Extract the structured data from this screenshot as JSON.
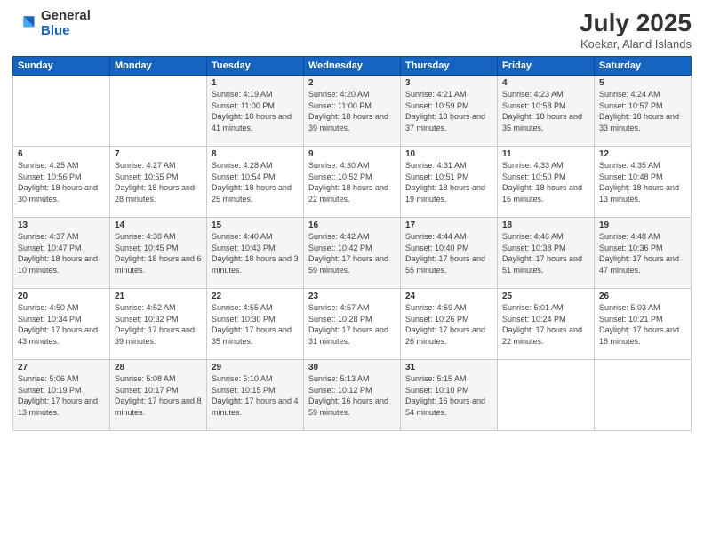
{
  "logo": {
    "general": "General",
    "blue": "Blue"
  },
  "header": {
    "month": "July 2025",
    "location": "Koekar, Aland Islands"
  },
  "weekdays": [
    "Sunday",
    "Monday",
    "Tuesday",
    "Wednesday",
    "Thursday",
    "Friday",
    "Saturday"
  ],
  "weeks": [
    [
      {
        "day": "",
        "info": ""
      },
      {
        "day": "",
        "info": ""
      },
      {
        "day": "1",
        "info": "Sunrise: 4:19 AM\nSunset: 11:00 PM\nDaylight: 18 hours\nand 41 minutes."
      },
      {
        "day": "2",
        "info": "Sunrise: 4:20 AM\nSunset: 11:00 PM\nDaylight: 18 hours\nand 39 minutes."
      },
      {
        "day": "3",
        "info": "Sunrise: 4:21 AM\nSunset: 10:59 PM\nDaylight: 18 hours\nand 37 minutes."
      },
      {
        "day": "4",
        "info": "Sunrise: 4:23 AM\nSunset: 10:58 PM\nDaylight: 18 hours\nand 35 minutes."
      },
      {
        "day": "5",
        "info": "Sunrise: 4:24 AM\nSunset: 10:57 PM\nDaylight: 18 hours\nand 33 minutes."
      }
    ],
    [
      {
        "day": "6",
        "info": "Sunrise: 4:25 AM\nSunset: 10:56 PM\nDaylight: 18 hours\nand 30 minutes."
      },
      {
        "day": "7",
        "info": "Sunrise: 4:27 AM\nSunset: 10:55 PM\nDaylight: 18 hours\nand 28 minutes."
      },
      {
        "day": "8",
        "info": "Sunrise: 4:28 AM\nSunset: 10:54 PM\nDaylight: 18 hours\nand 25 minutes."
      },
      {
        "day": "9",
        "info": "Sunrise: 4:30 AM\nSunset: 10:52 PM\nDaylight: 18 hours\nand 22 minutes."
      },
      {
        "day": "10",
        "info": "Sunrise: 4:31 AM\nSunset: 10:51 PM\nDaylight: 18 hours\nand 19 minutes."
      },
      {
        "day": "11",
        "info": "Sunrise: 4:33 AM\nSunset: 10:50 PM\nDaylight: 18 hours\nand 16 minutes."
      },
      {
        "day": "12",
        "info": "Sunrise: 4:35 AM\nSunset: 10:48 PM\nDaylight: 18 hours\nand 13 minutes."
      }
    ],
    [
      {
        "day": "13",
        "info": "Sunrise: 4:37 AM\nSunset: 10:47 PM\nDaylight: 18 hours\nand 10 minutes."
      },
      {
        "day": "14",
        "info": "Sunrise: 4:38 AM\nSunset: 10:45 PM\nDaylight: 18 hours\nand 6 minutes."
      },
      {
        "day": "15",
        "info": "Sunrise: 4:40 AM\nSunset: 10:43 PM\nDaylight: 18 hours\nand 3 minutes."
      },
      {
        "day": "16",
        "info": "Sunrise: 4:42 AM\nSunset: 10:42 PM\nDaylight: 17 hours\nand 59 minutes."
      },
      {
        "day": "17",
        "info": "Sunrise: 4:44 AM\nSunset: 10:40 PM\nDaylight: 17 hours\nand 55 minutes."
      },
      {
        "day": "18",
        "info": "Sunrise: 4:46 AM\nSunset: 10:38 PM\nDaylight: 17 hours\nand 51 minutes."
      },
      {
        "day": "19",
        "info": "Sunrise: 4:48 AM\nSunset: 10:36 PM\nDaylight: 17 hours\nand 47 minutes."
      }
    ],
    [
      {
        "day": "20",
        "info": "Sunrise: 4:50 AM\nSunset: 10:34 PM\nDaylight: 17 hours\nand 43 minutes."
      },
      {
        "day": "21",
        "info": "Sunrise: 4:52 AM\nSunset: 10:32 PM\nDaylight: 17 hours\nand 39 minutes."
      },
      {
        "day": "22",
        "info": "Sunrise: 4:55 AM\nSunset: 10:30 PM\nDaylight: 17 hours\nand 35 minutes."
      },
      {
        "day": "23",
        "info": "Sunrise: 4:57 AM\nSunset: 10:28 PM\nDaylight: 17 hours\nand 31 minutes."
      },
      {
        "day": "24",
        "info": "Sunrise: 4:59 AM\nSunset: 10:26 PM\nDaylight: 17 hours\nand 26 minutes."
      },
      {
        "day": "25",
        "info": "Sunrise: 5:01 AM\nSunset: 10:24 PM\nDaylight: 17 hours\nand 22 minutes."
      },
      {
        "day": "26",
        "info": "Sunrise: 5:03 AM\nSunset: 10:21 PM\nDaylight: 17 hours\nand 18 minutes."
      }
    ],
    [
      {
        "day": "27",
        "info": "Sunrise: 5:06 AM\nSunset: 10:19 PM\nDaylight: 17 hours\nand 13 minutes."
      },
      {
        "day": "28",
        "info": "Sunrise: 5:08 AM\nSunset: 10:17 PM\nDaylight: 17 hours\nand 8 minutes."
      },
      {
        "day": "29",
        "info": "Sunrise: 5:10 AM\nSunset: 10:15 PM\nDaylight: 17 hours\nand 4 minutes."
      },
      {
        "day": "30",
        "info": "Sunrise: 5:13 AM\nSunset: 10:12 PM\nDaylight: 16 hours\nand 59 minutes."
      },
      {
        "day": "31",
        "info": "Sunrise: 5:15 AM\nSunset: 10:10 PM\nDaylight: 16 hours\nand 54 minutes."
      },
      {
        "day": "",
        "info": ""
      },
      {
        "day": "",
        "info": ""
      }
    ]
  ]
}
